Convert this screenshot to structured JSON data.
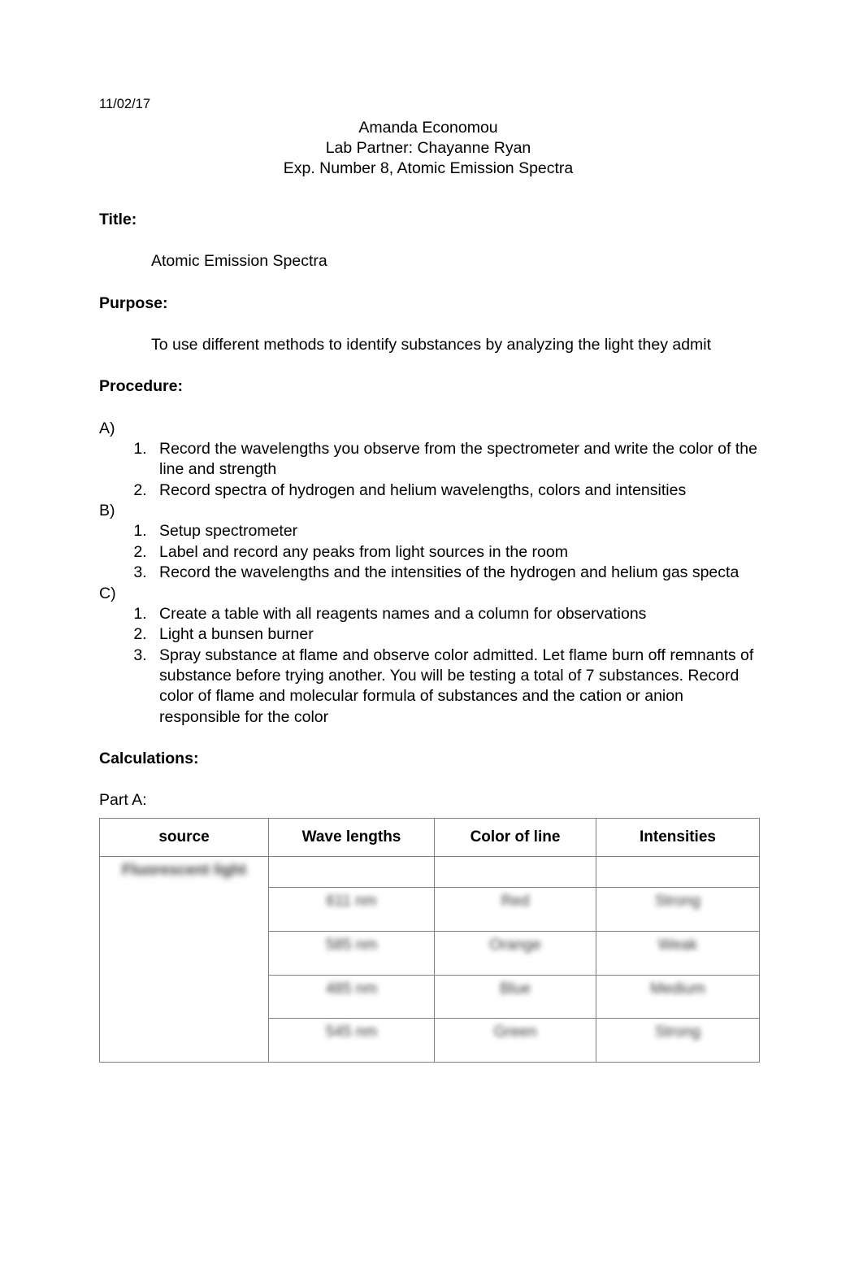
{
  "document": {
    "date": "11/02/17",
    "header_lines": [
      "Amanda Economou",
      "Lab Partner: Chayanne Ryan",
      "Exp. Number 8, Atomic Emission Spectra"
    ],
    "sections": {
      "title_heading": "Title:",
      "title_body": "Atomic Emission Spectra",
      "purpose_heading": "Purpose:",
      "purpose_body": "To use different methods to identify substances by analyzing the light they admit",
      "procedure_heading": "Procedure:",
      "calculations_heading": "Calculations:",
      "part_a_label": "Part A:"
    },
    "procedure": {
      "groups": [
        {
          "letter": "A)",
          "steps": [
            "Record the wavelengths you observe from the spectrometer and write the color of the line and strength",
            "Record spectra of hydrogen and helium wavelengths, colors and intensities"
          ]
        },
        {
          "letter": "B)",
          "steps": [
            "Setup spectrometer",
            "Label and record any peaks from light sources in the room",
            "Record the wavelengths and the intensities of the hydrogen and helium gas specta"
          ]
        },
        {
          "letter": "C)",
          "steps": [
            "Create a table with all reagents names and a column for observations",
            "Light a bunsen burner",
            "Spray substance at flame and observe color admitted.  Let flame burn off remnants of substance before trying another.  You will be testing a total of 7 substances.  Record color of flame and molecular formula of substances and the cation or anion responsible for the color"
          ]
        }
      ]
    },
    "part_a_table": {
      "columns": [
        "source",
        "Wave lengths",
        "Color of line",
        "Intensities"
      ],
      "source_cell": "Fluorescent light",
      "blank_row": [
        "",
        "",
        "",
        ""
      ],
      "rows": [
        {
          "wavelength": "611 nm",
          "color": "Red",
          "intensity": "Strong"
        },
        {
          "wavelength": "585 nm",
          "color": "Orange",
          "intensity": "Weak"
        },
        {
          "wavelength": "485 nm",
          "color": "Blue",
          "intensity": "Medium"
        },
        {
          "wavelength": "545 nm",
          "color": "Green",
          "intensity": "Strong"
        }
      ]
    }
  }
}
